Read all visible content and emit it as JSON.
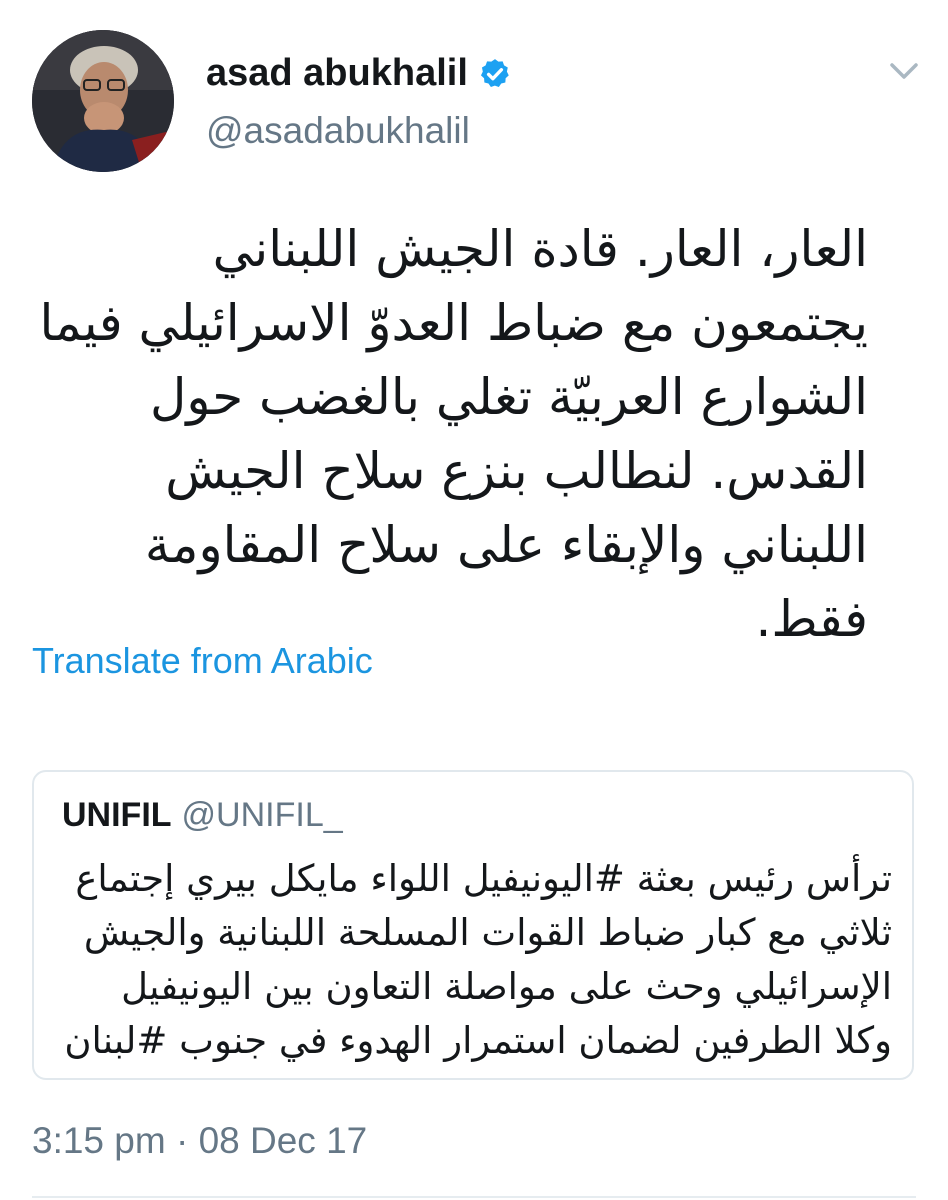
{
  "author": {
    "display_name": "asad abukhalil",
    "handle": "@asadabukhalil",
    "verified": true,
    "avatar_icon": "user-avatar-photo"
  },
  "tweet": {
    "text": "العار، العار. قادة الجيش اللبناني يجتمعون مع ضباط العدوّ الاسرائيلي فيما الشوارع العربيّة تغلي بالغضب حول القدس. لنطالب بنزع سلاح الجيش اللبناني والإبقاء على سلاح المقاومة فقط.",
    "translate_label": "Translate from Arabic",
    "timestamp": "3:15 pm · 08 Dec 17"
  },
  "quoted_tweet": {
    "name": "UNIFIL",
    "handle": "@UNIFIL_",
    "text": "ترأس رئيس بعثة #اليونيفيل اللواء مايكل بيري إجتماع ثلاثي مع كبار ضباط القوات المسلحة اللبنانية والجيش الإسرائيلي وحث على مواصلة التعاون بين اليونيفيل وكلا الطرفين لضمان استمرار الهدوء في جنوب #لبنان"
  },
  "colors": {
    "text_primary": "#14171a",
    "text_secondary": "#657786",
    "link": "#1b95e0",
    "verified_badge": "#1da1f2",
    "border": "#e1e8ed"
  },
  "icons": {
    "verified": "verified-badge-icon",
    "more_menu": "chevron-down-icon"
  }
}
